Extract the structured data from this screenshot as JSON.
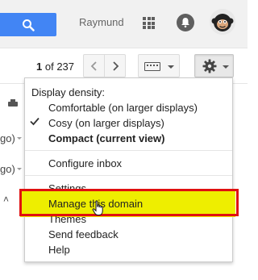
{
  "header": {
    "username": "Raymund",
    "icons": [
      "search-icon",
      "apps-grid-icon",
      "notifications-icon",
      "avatar"
    ]
  },
  "toolbar": {
    "pager_current": "1",
    "pager_of": "of",
    "pager_total": "237"
  },
  "background": {
    "fragment_1": "go)",
    "fragment_2": "go)"
  },
  "settings_menu": {
    "section_label": "Display density:",
    "density_options": [
      {
        "label": "Comfortable (on larger displays)",
        "checked": false,
        "bold": false
      },
      {
        "label": "Cosy (on larger displays)",
        "checked": true,
        "bold": false
      },
      {
        "label": "Compact (current view)",
        "checked": false,
        "bold": true
      }
    ],
    "configure_inbox": "Configure inbox",
    "items": [
      "Settings",
      "Manage this domain",
      "Themes",
      "Send feedback",
      "Help"
    ]
  },
  "colors": {
    "accent_blue": "#4285f4",
    "highlight_red": "#e01010",
    "highlight_yellow": "#eeee00"
  }
}
